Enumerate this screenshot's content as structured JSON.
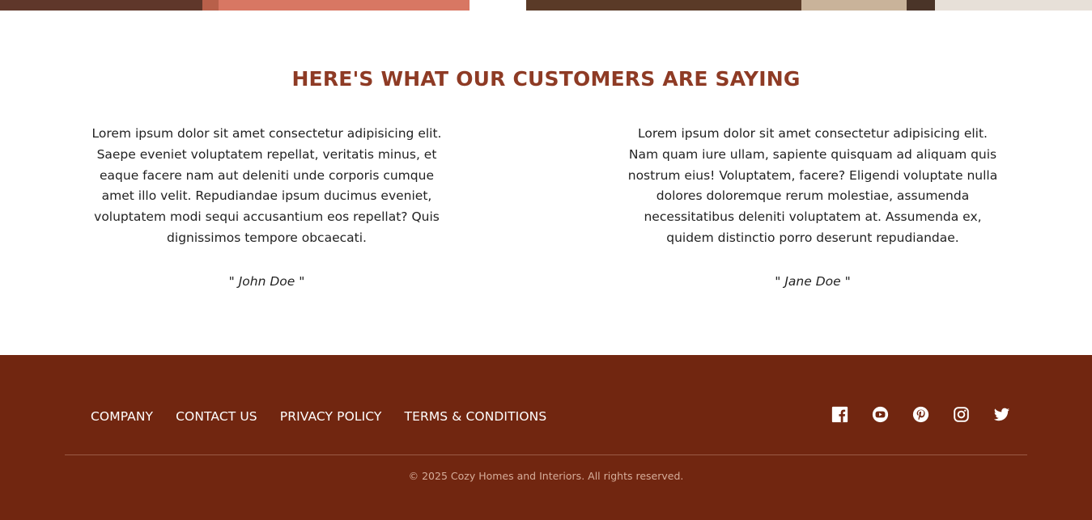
{
  "hero": {
    "colors": [
      "#5f372a",
      "#c8684f",
      "#d87763",
      "#ffffff",
      "#5a3a27",
      "#c9b39a",
      "#4a3428",
      "#e7e0d8"
    ]
  },
  "testimonials": {
    "title": "HERE'S WHAT OUR CUSTOMERS ARE SAYING",
    "items": [
      {
        "quote": "Lorem ipsum dolor sit amet consectetur adipisicing elit. Saepe eveniet voluptatem repellat, veritatis minus, et eaque facere nam aut deleniti unde corporis cumque amet illo velit. Repudiandae ipsum ducimus eveniet, voluptatem modi sequi accusantium eos repellat? Quis dignissimos tempore obcaecati.",
        "author": "\" John Doe \""
      },
      {
        "quote": "Lorem ipsum dolor sit amet consectetur adipisicing elit. Nam quam iure ullam, sapiente quisquam ad aliquam quis nostrum eius! Voluptatem, facere? Eligendi voluptate nulla dolores doloremque rerum molestiae, assumenda necessitatibus deleniti voluptatem at. Assumenda ex, quidem distinctio porro deserunt repudiandae.",
        "author": "\" Jane Doe \""
      }
    ]
  },
  "footer": {
    "nav": [
      "COMPANY",
      "CONTACT US",
      "PRIVACY POLICY",
      "TERMS & CONDITIONS"
    ],
    "social_icons": [
      "facebook-icon",
      "youtube-icon",
      "pinterest-icon",
      "instagram-icon",
      "twitter-icon"
    ],
    "copyright": "© 2025 Cozy Homes and Interiors. All rights reserved.",
    "background_color": "#712610"
  },
  "colors": {
    "accent": "#8e3b25",
    "footer_bg": "#712610"
  }
}
